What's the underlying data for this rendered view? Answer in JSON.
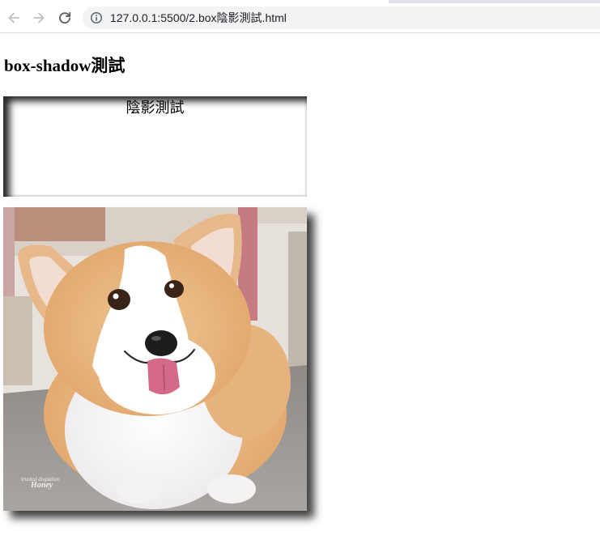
{
  "browser": {
    "address_bar": {
      "url": "127.0.0.1:5500/2.box陰影測試.html"
    },
    "icons": {
      "back": "arrow-left-icon",
      "forward": "arrow-right-icon",
      "reload": "reload-icon",
      "site_info": "info-icon"
    }
  },
  "page": {
    "heading": "box-shadow測試",
    "shadow_box": {
      "text": "陰影測試"
    },
    "photo": {
      "subject": "corgi-dog-photo",
      "watermark_line1": "trusted dogsalon",
      "watermark_line2": "Honey"
    }
  },
  "colors": {
    "toolbar_bg": "#ffffff",
    "omnibox_bg": "#f1f3f4",
    "icon_disabled": "#bdc1c6",
    "icon_enabled": "#5f6368"
  }
}
